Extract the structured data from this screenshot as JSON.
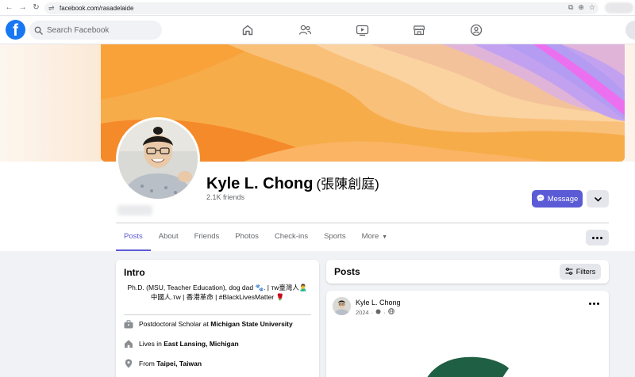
{
  "browser": {
    "url": "facebook.com/rasadelaide"
  },
  "search": {
    "placeholder": "Search Facebook"
  },
  "brand": {
    "logo_letter": "f",
    "accent": "#5b5bd6",
    "fb_blue": "#1877f2"
  },
  "nav_icons": [
    "home-icon",
    "friends-icon",
    "video-icon",
    "marketplace-icon",
    "groups-icon"
  ],
  "profile": {
    "name": "Kyle L. Chong",
    "alt_name": "(張陳創庭)",
    "friends": "2.1K friends"
  },
  "actions": {
    "message_label": "Message"
  },
  "tabs": [
    {
      "label": "Posts",
      "active": true
    },
    {
      "label": "About",
      "active": false
    },
    {
      "label": "Friends",
      "active": false
    },
    {
      "label": "Photos",
      "active": false
    },
    {
      "label": "Check-ins",
      "active": false
    },
    {
      "label": "Sports",
      "active": false
    },
    {
      "label": "More",
      "active": false
    }
  ],
  "intro": {
    "title": "Intro",
    "bio": "Ph.D. (MSU, Teacher Education), dog dad 🐾. | ᴛᴡ臺灣人🙎‍♂️ 中國人.ᴛᴡ | 香港革命 | #BlackLivesMatter 🌹",
    "job_prefix": "Postdoctoral Scholar at ",
    "job_org": "Michigan State University",
    "lives_prefix": "Lives in ",
    "lives_place": "East Lansing, Michigan",
    "from_prefix": "From ",
    "from_place": "Taipei, Taiwan"
  },
  "posts": {
    "title": "Posts",
    "filters_label": "Filters"
  },
  "post": {
    "author": "Kyle L. Chong",
    "year": "2024",
    "sep": "·"
  }
}
